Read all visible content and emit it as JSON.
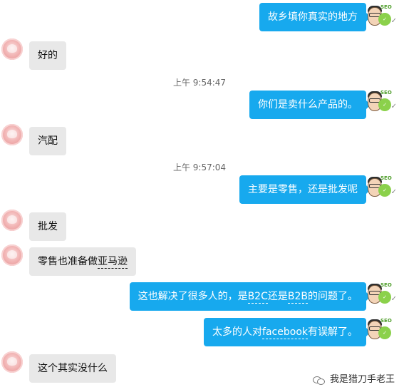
{
  "messages": [
    {
      "side": "right",
      "text": "故乡填你真实的地方"
    },
    {
      "side": "left",
      "text": "好的"
    },
    {
      "side": "time",
      "text": "上午 9:54:47"
    },
    {
      "side": "right",
      "text": "你们是卖什么产品的。"
    },
    {
      "side": "left",
      "text": "汽配"
    },
    {
      "side": "time",
      "text": "上午 9:57:04"
    },
    {
      "side": "right",
      "text": "主要是零售，还是批发呢"
    },
    {
      "side": "left",
      "text": "批发"
    },
    {
      "side": "left",
      "parts": [
        "零售也准备做",
        "亚马逊"
      ]
    },
    {
      "side": "right",
      "parts": [
        "这也解决了很多人的，是",
        "B2C",
        "还是",
        "B2B",
        "的问题了。"
      ]
    },
    {
      "side": "right",
      "parts": [
        "太多的人对",
        "facebook",
        "有误解了。"
      ]
    },
    {
      "side": "left",
      "text": "这个其实没什么"
    }
  ],
  "avatar_right_badge": "SEO",
  "check_mark": "✓",
  "watermark": {
    "icon": "wechat-icon",
    "text": "我是猎刀手老王"
  }
}
